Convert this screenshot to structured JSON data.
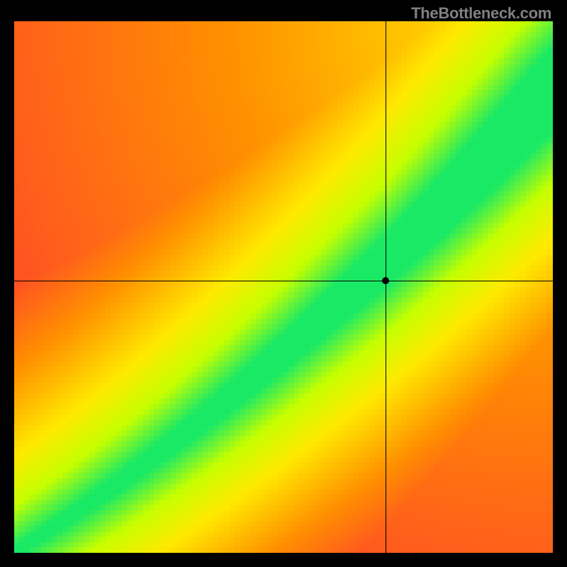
{
  "watermark": "TheBottleneck.com",
  "colors": {
    "red": "#ff1744",
    "orange": "#ff9100",
    "yellow": "#ffea00",
    "yellgreen": "#c6ff00",
    "green": "#00e676",
    "crosshair": "#000000",
    "background": "#000000"
  },
  "chart_data": {
    "type": "heatmap",
    "description": "Bottleneck compatibility heatmap. Both axes represent a normalized performance index 0–1. The green diagonal ridge marks balanced pairings (low bottleneck). Moving away from the ridge transitions yellow → orange → red (high bottleneck). The ridge is slightly sub-linear and the green band widens toward the top-right.",
    "xlabel": "",
    "ylabel": "",
    "xlim": [
      0,
      1
    ],
    "ylim": [
      0,
      1
    ],
    "grid_resolution": 100,
    "ridge_curve_samples": [
      {
        "x": 0.0,
        "y": 0.0
      },
      {
        "x": 0.1,
        "y": 0.065
      },
      {
        "x": 0.2,
        "y": 0.135
      },
      {
        "x": 0.3,
        "y": 0.21
      },
      {
        "x": 0.4,
        "y": 0.29
      },
      {
        "x": 0.5,
        "y": 0.375
      },
      {
        "x": 0.6,
        "y": 0.465
      },
      {
        "x": 0.7,
        "y": 0.555
      },
      {
        "x": 0.8,
        "y": 0.655
      },
      {
        "x": 0.9,
        "y": 0.76
      },
      {
        "x": 1.0,
        "y": 0.87
      }
    ],
    "ridge_half_width_samples": [
      {
        "t": 0.0,
        "w": 0.01
      },
      {
        "t": 0.25,
        "w": 0.02
      },
      {
        "t": 0.5,
        "w": 0.035
      },
      {
        "t": 0.75,
        "w": 0.055
      },
      {
        "t": 1.0,
        "w": 0.08
      }
    ],
    "color_stops": [
      {
        "score": 0.0,
        "color": "#ff1744"
      },
      {
        "score": 0.45,
        "color": "#ff9100"
      },
      {
        "score": 0.7,
        "color": "#ffea00"
      },
      {
        "score": 0.85,
        "color": "#c6ff00"
      },
      {
        "score": 1.0,
        "color": "#00e676"
      }
    ],
    "marker": {
      "x": 0.69,
      "y": 0.512
    }
  }
}
